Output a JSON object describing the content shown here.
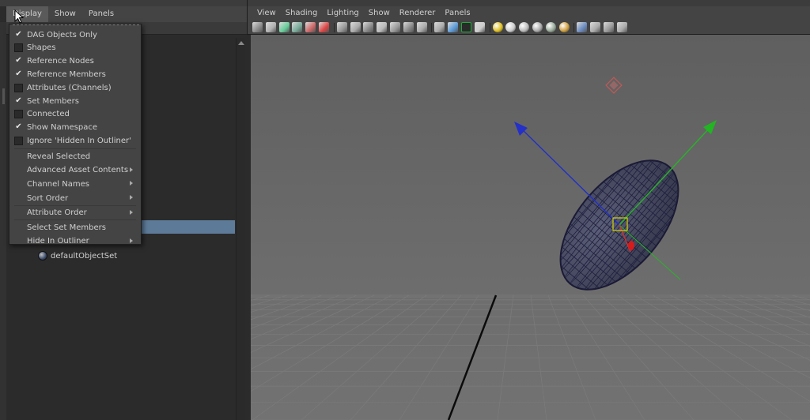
{
  "outliner": {
    "menu": [
      "Display",
      "Show",
      "Panels"
    ],
    "active_menu": "Display",
    "items": [
      {
        "label": "defaultObjectSet",
        "icon": "set-icon"
      }
    ]
  },
  "display_menu": {
    "checkable": [
      {
        "label": "DAG Objects Only",
        "checked": true
      },
      {
        "label": "Shapes",
        "checked": false
      },
      {
        "label": "Reference Nodes",
        "checked": true
      },
      {
        "label": "Reference Members",
        "checked": true
      },
      {
        "label": "Attributes (Channels)",
        "checked": false
      },
      {
        "label": "Set Members",
        "checked": true
      },
      {
        "label": "Connected",
        "checked": false
      },
      {
        "label": "Show Namespace",
        "checked": true
      },
      {
        "label": "Ignore 'Hidden In Outliner'",
        "checked": false
      }
    ],
    "actions": [
      {
        "label": "Reveal Selected",
        "submenu": false
      },
      {
        "label": "Advanced Asset Contents",
        "submenu": true
      },
      {
        "label": "Channel Names",
        "submenu": true
      },
      {
        "label": "Sort Order",
        "submenu": true
      },
      {
        "label": "Attribute Order",
        "submenu": true
      },
      {
        "label": "Select Set Members",
        "submenu": false
      },
      {
        "label": "Hide In Outliner",
        "submenu": true
      }
    ],
    "check_glyph": "✔"
  },
  "viewport": {
    "menu": [
      "View",
      "Shading",
      "Lighting",
      "Show",
      "Renderer",
      "Panels"
    ],
    "toolbar_icons": [
      "camera-select-icon",
      "camera-attributes-icon",
      "bookmarks-icon",
      "image-plane-icon",
      "2d-pan-zoom-icon",
      "grease-pencil-icon",
      "grid-icon",
      "film-gate-icon",
      "resolution-gate-icon",
      "gate-mask-icon",
      "field-chart-icon",
      "safe-action-icon",
      "safe-title-icon",
      "wireframe-icon",
      "smooth-shade-icon",
      "wireframe-on-shaded-icon",
      "textured-icon",
      "use-all-lights-icon",
      "shadows-icon",
      "screen-space-ao-icon",
      "motion-blur-icon",
      "multisample-aa-icon",
      "depth-of-field-icon",
      "isolate-select-icon",
      "xray-icon",
      "xray-active-components-icon",
      "xray-joints-icon"
    ],
    "colors": {
      "background_top": "#5f5f5f",
      "background_bottom": "#727272",
      "mesh_fill": "#4a4d63",
      "mesh_wire": "#1e1e3c",
      "axis_x": "#d23232",
      "axis_y": "#28b428",
      "axis_z": "#2030c8",
      "pivot": "#d4d400",
      "grid": "#7a7a7a",
      "selection": "#5d7b98"
    }
  }
}
